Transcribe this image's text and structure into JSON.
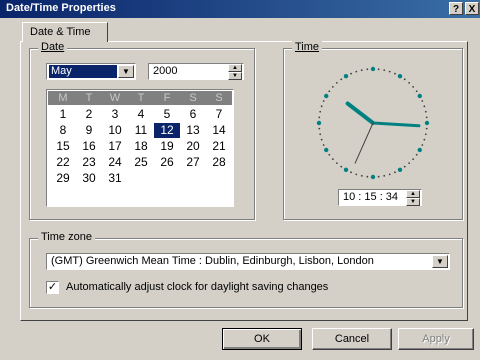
{
  "window": {
    "title": "Date/Time Properties",
    "help_glyph": "?",
    "close_glyph": "X"
  },
  "tab": {
    "label": "Date & Time"
  },
  "date": {
    "group_label": "Date",
    "month": "May",
    "year": "2000",
    "weekdays": [
      "M",
      "T",
      "W",
      "T",
      "F",
      "S",
      "S"
    ],
    "weeks": [
      [
        "",
        "",
        "",
        "",
        "",
        "",
        ""
      ],
      [
        "1",
        "2",
        "3",
        "4",
        "5",
        "6",
        "7"
      ],
      [
        "8",
        "9",
        "10",
        "11",
        "12",
        "13",
        "14"
      ],
      [
        "15",
        "16",
        "17",
        "18",
        "19",
        "20",
        "21"
      ],
      [
        "22",
        "23",
        "24",
        "25",
        "26",
        "27",
        "28"
      ],
      [
        "29",
        "30",
        "31",
        "",
        "",
        "",
        ""
      ]
    ],
    "selected_day": "12"
  },
  "time": {
    "group_label": "Time",
    "value": "10 : 15 : 34",
    "hour": 10,
    "minute": 15,
    "second": 34
  },
  "timezone": {
    "group_label": "Time zone",
    "value": "(GMT) Greenwich Mean Time : Dublin, Edinburgh, Lisbon, London",
    "dst_checked": true,
    "dst_label": "Automatically adjust clock for daylight saving changes"
  },
  "buttons": {
    "ok": "OK",
    "cancel": "Cancel",
    "apply": "Apply"
  },
  "icons": {
    "dropdown": "▼",
    "spin_up": "▲",
    "spin_down": "▼",
    "check": "✓"
  },
  "colors": {
    "face": "#d4d0c8",
    "titlebar_start": "#0a246a",
    "titlebar_end": "#3a6ea5",
    "clock_hands": "#008080",
    "clock_dots": "#008080",
    "second_hand": "#404040"
  }
}
